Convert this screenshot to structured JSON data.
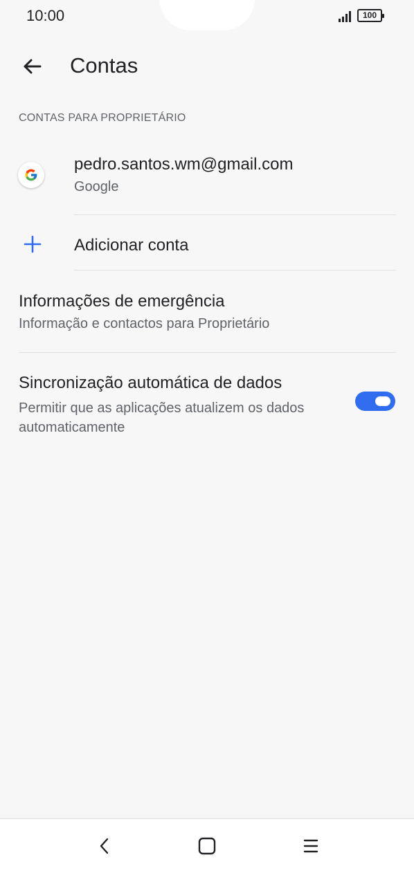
{
  "status_bar": {
    "time": "10:00",
    "battery": "100"
  },
  "app_bar": {
    "title": "Contas",
    "back_icon": "arrow-back-icon"
  },
  "section": {
    "header": "CONTAS PARA PROPRIETÁRIO"
  },
  "account": {
    "email": "pedro.santos.wm@gmail.com",
    "type": "Google",
    "icon": "google-icon"
  },
  "add_account": {
    "label": "Adicionar conta",
    "icon": "plus-icon"
  },
  "emergency": {
    "title": "Informações de emergência",
    "subtitle": "Informação e contactos para Proprietário"
  },
  "sync": {
    "title": "Sincronização automática de dados",
    "subtitle": "Permitir que as aplicações atualizem os dados automaticamente",
    "enabled": true
  },
  "nav_bar": {
    "back_icon": "nav-back-icon",
    "home_icon": "nav-home-icon",
    "menu_icon": "nav-menu-icon"
  },
  "colors": {
    "background": "#f7f7f7",
    "accent": "#2f6cf0",
    "primary_text": "#202124",
    "secondary_text": "#5f6368"
  }
}
